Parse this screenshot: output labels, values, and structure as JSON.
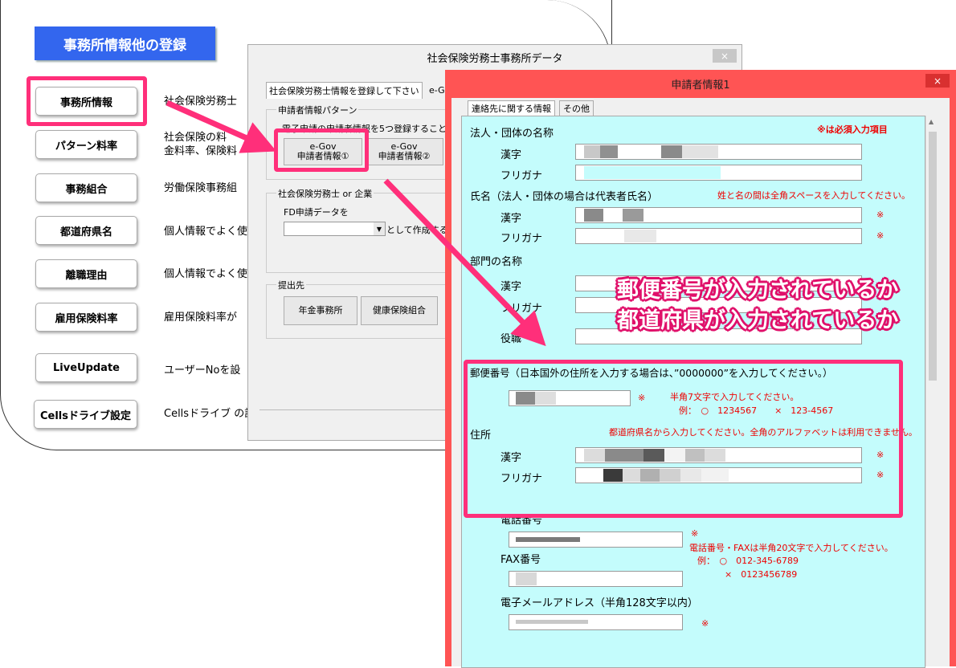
{
  "menu": {
    "title": "事務所情報他の登録",
    "items": [
      {
        "label": "事務所情報",
        "desc": "社会保険労務士"
      },
      {
        "label": "パターン料率",
        "desc": "社会保険の料\n金料率、保険料"
      },
      {
        "label": "事務組合",
        "desc": "労働保険事務組"
      },
      {
        "label": "都道府県名",
        "desc": "個人情報でよく使"
      },
      {
        "label": "離職理由",
        "desc": "個人情報でよく使"
      },
      {
        "label": "雇用保険料率",
        "desc": "雇用保険料率が"
      },
      {
        "label": "LiveUpdate",
        "desc": "ユーザーNoを設"
      },
      {
        "label": "Cellsドライブ設定",
        "desc": "Cellsドライブ の設"
      }
    ]
  },
  "win1": {
    "title": "社会保険労務士事務所データ",
    "close": "×",
    "tab1": "社会保険労務士情報を登録して下さい",
    "tab2": "e-G",
    "group1_label": "申請者情報パターン",
    "group1_desc": "電子申請の申請者情報を5つ登録すること",
    "btn1": "e-Gov\n申請者情報①",
    "btn2": "e-Gov\n申請者情報②",
    "group2_label": "社会保険労務士 or 企業",
    "fd_label": "FD申請データを",
    "fd_suffix": "として作成する。",
    "group3_label": "提出先",
    "dest1": "年金事務所",
    "dest2": "健康保険組合"
  },
  "win2": {
    "title": "申請者情報1",
    "close": "×",
    "tab1": "連絡先に関する情報",
    "tab2": "その他",
    "required_note": "※は必須入力項目",
    "corp_name": "法人・団体の名称",
    "kanji": "漢字",
    "furigana": "フリガナ",
    "person_name": "氏名（法人・団体の場合は代表者氏名）",
    "name_note": "姓と名の間は全角スペースを入力してください。",
    "dept": "部門の名称",
    "title_field": "役職",
    "postal": "郵便番号（日本国外の住所を入力する場合は、”0000000”を入力してください。）",
    "postal_note": "半角7文字で入力してください。",
    "postal_example": "例：　○　1234567　　×　123-4567",
    "address": "住所",
    "address_note": "都道府県名から入力してください。全角のアルファベットは利用できません。",
    "phone": "電話番号",
    "fax": "FAX番号",
    "phone_note": "電話番号・FAXは半角20文字で入力してください。",
    "phone_example_ok": "例：　○　012-345-6789",
    "phone_example_ng": "×　0123456789",
    "email": "電子メールアドレス（半角128文字以内）",
    "star": "※"
  },
  "callout": {
    "line1": "郵便番号が入力されているか",
    "line2": "都道府県が入力されているか"
  },
  "colors": {
    "highlight": "#ff2f7a",
    "window_accent": "#ff5454",
    "form_bg": "#c4fcfc",
    "menu_title_bg": "#3366ee"
  }
}
